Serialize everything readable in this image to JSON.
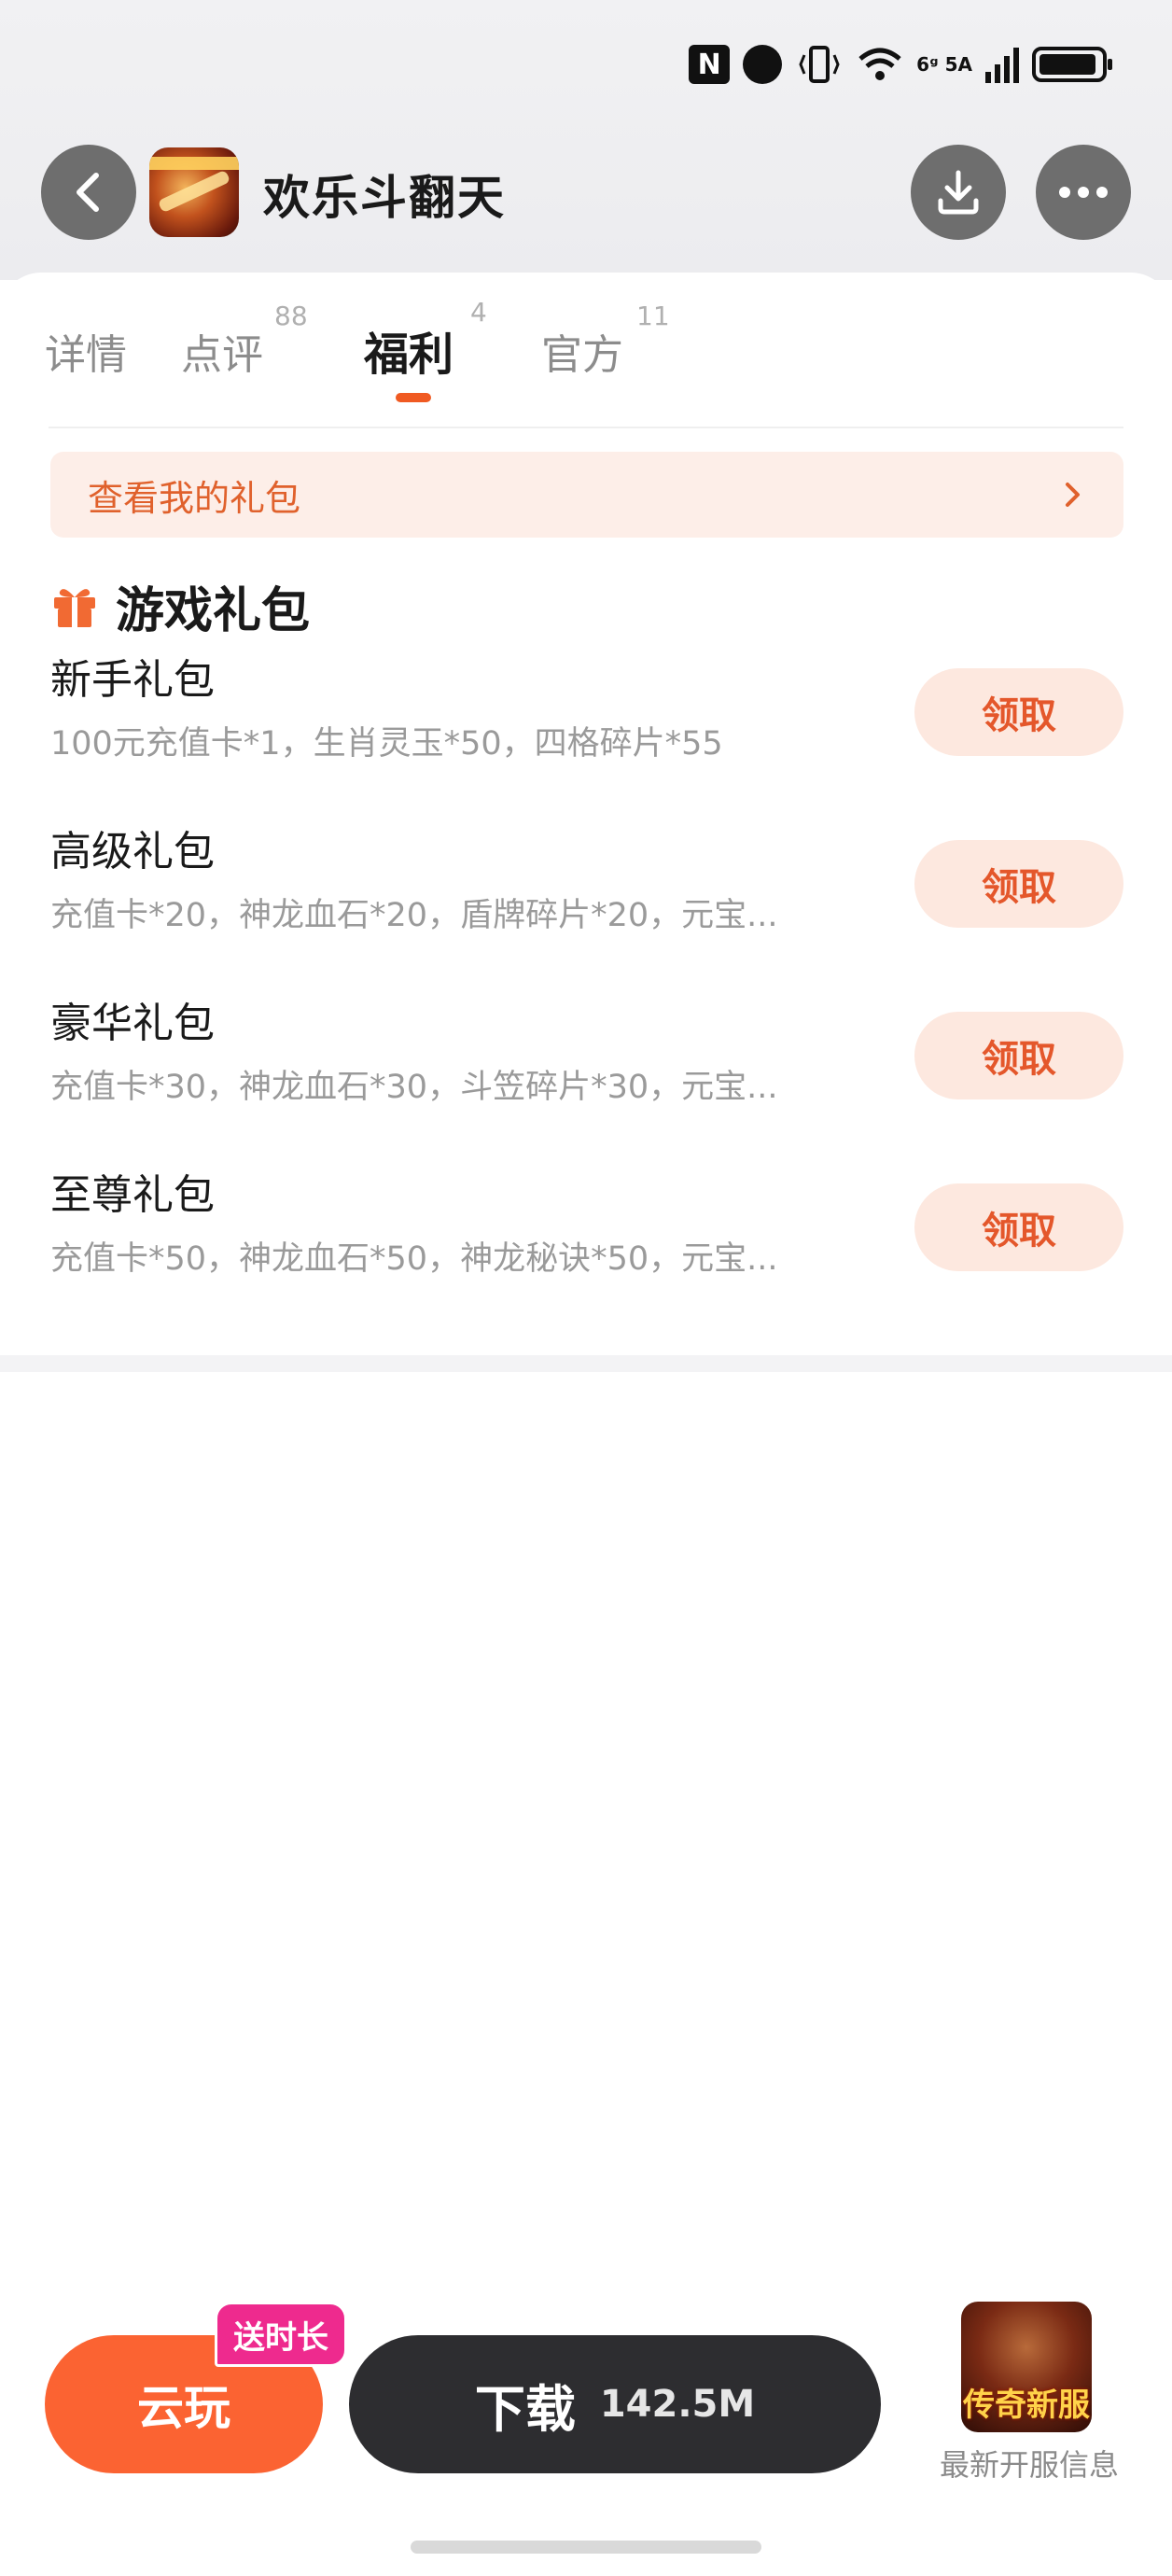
{
  "status_bar": {
    "network": "6ᵍ 5A"
  },
  "header": {
    "app_title": "欢乐斗翻天"
  },
  "tabs": [
    {
      "label": "详情",
      "count": ""
    },
    {
      "label": "点评",
      "count": "88"
    },
    {
      "label": "福利",
      "count": "4"
    },
    {
      "label": "官方",
      "count": "11"
    }
  ],
  "active_tab": "福利",
  "my_gift_link": {
    "label": "查看我的礼包"
  },
  "section": {
    "title": "游戏礼包"
  },
  "gifts": [
    {
      "name": "新手礼包",
      "desc": "100元充值卡*1，生肖灵玉*50，四格碎片*55",
      "action": "领取"
    },
    {
      "name": "高级礼包",
      "desc": "充值卡*20，神龙血石*20，盾牌碎片*20，元宝...",
      "action": "领取"
    },
    {
      "name": "豪华礼包",
      "desc": "充值卡*30，神龙血石*30，斗笠碎片*30，元宝...",
      "action": "领取"
    },
    {
      "name": "至尊礼包",
      "desc": "充值卡*50，神龙血石*50，神龙秘诀*50，元宝...",
      "action": "领取"
    }
  ],
  "bottom_bar": {
    "cloud_play_label": "云玩",
    "cloud_badge": "送时长",
    "download_label": "下载",
    "download_size": "142.5M",
    "server_icon_text": "传奇新服",
    "server_label": "最新开服信息"
  },
  "colors": {
    "accent": "#f05a22",
    "cloud_button": "#fb6332",
    "badge": "#ee2a8e",
    "download_button": "#2d2d30"
  }
}
